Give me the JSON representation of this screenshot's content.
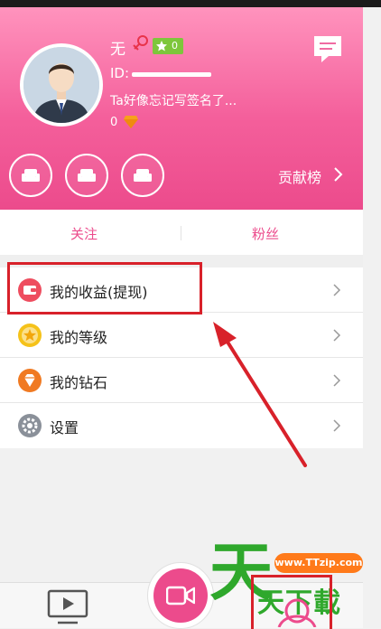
{
  "profile": {
    "username": "无",
    "level": "0",
    "id_label": "ID:",
    "signature": "Ta好像忘记写签名了...",
    "diamond_count": "0"
  },
  "header": {
    "contribution_label": "贡献榜"
  },
  "tabs": [
    {
      "label": "关注"
    },
    {
      "label": "粉丝"
    }
  ],
  "menu": [
    {
      "label": "我的收益(提现)",
      "icon": "wallet-icon"
    },
    {
      "label": "我的等级",
      "icon": "star-badge-icon"
    },
    {
      "label": "我的钻石",
      "icon": "diamond-icon"
    },
    {
      "label": "设置",
      "icon": "gear-icon"
    }
  ],
  "watermark": {
    "url": "www.TTzip.com",
    "big": "天",
    "small": "天下載"
  },
  "colors": {
    "accent": "#ec4b8c",
    "header_top": "#ff93bd",
    "highlight": "#d8212a",
    "level_badge": "#7ec63b",
    "watermark_green": "#2fa82c",
    "watermark_orange": "#ff7a1a"
  }
}
